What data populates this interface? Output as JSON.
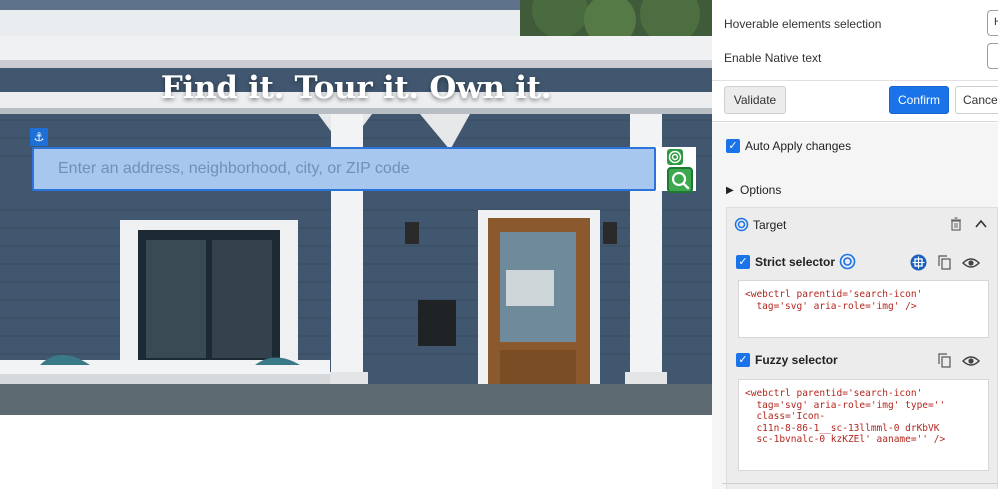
{
  "hero": {
    "title": "Find it. Tour it. Own it.",
    "search_placeholder": "Enter an address, neighborhood, city, or ZIP code"
  },
  "panel": {
    "hoverable_label": "Hoverable elements selection",
    "hoverable_value": "H",
    "native_text_label": "Enable Native text",
    "buttons": {
      "validate": "Validate",
      "confirm": "Confirm",
      "cancel": "Cance"
    },
    "auto_apply_label": "Auto Apply changes",
    "options_label": "Options",
    "target_label": "Target",
    "strict_selector_label": "Strict selector",
    "strict_selector_code": "<webctrl parentid='search-icon'\n  tag='svg' aria-role='img' />",
    "fuzzy_selector_label": "Fuzzy selector",
    "fuzzy_selector_code": "<webctrl parentid='search-icon'\n  tag='svg' aria-role='img' type=''\n  class='Icon-\n  c11n-8-86-1__sc-13llmml-0 drKbVK\n  sc-1bvnalc-0 kzKZEl' aaname='' />"
  },
  "colors": {
    "accent": "#1a73e8",
    "search_fill": "#a7c7ef",
    "search_border": "#2b74d9",
    "match_green": "#3da84f",
    "code_text": "#b3261e"
  }
}
